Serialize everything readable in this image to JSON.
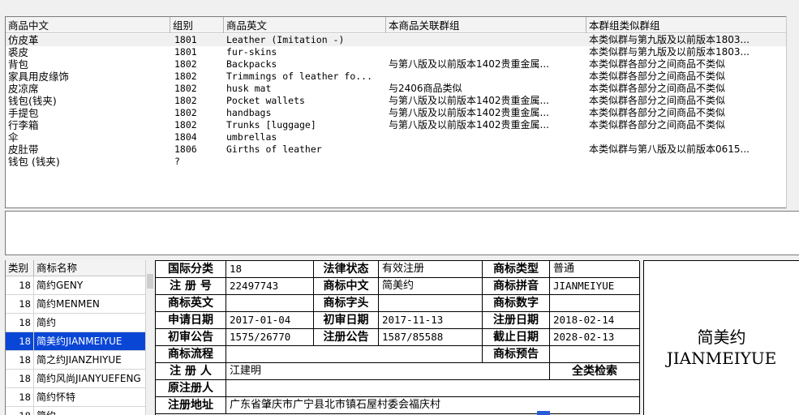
{
  "top_table": {
    "headers": [
      "商品中文",
      "组别",
      "商品英文",
      "本商品关联群组",
      "本群组类似群组"
    ],
    "rows": [
      [
        "仿皮革",
        "1801",
        "Leather (Imitation -)",
        "",
        "本类似群与第九版及以前版本1803..."
      ],
      [
        "裘皮",
        "1801",
        "fur-skins",
        "",
        "本类似群与第九版及以前版本1803..."
      ],
      [
        "背包",
        "1802",
        "Backpacks",
        "与第八版及以前版本1402贵重金属...",
        "本类似群各部分之间商品不类似"
      ],
      [
        "家具用皮缘饰",
        "1802",
        "Trimmings of leather fo...",
        "",
        "本类似群各部分之间商品不类似"
      ],
      [
        "皮凉席",
        "1802",
        "husk mat",
        "与2406商品类似",
        "本类似群各部分之间商品不类似"
      ],
      [
        "钱包(钱夹)",
        "1802",
        "Pocket wallets",
        "与第八版及以前版本1402贵重金属...",
        "本类似群各部分之间商品不类似"
      ],
      [
        "手提包",
        "1802",
        "handbags",
        "与第八版及以前版本1402贵重金属...",
        "本类似群各部分之间商品不类似"
      ],
      [
        "行李箱",
        "1802",
        "Trunks [luggage]",
        "与第八版及以前版本1402贵重金属...",
        "本类似群各部分之间商品不类似"
      ],
      [
        "伞",
        "1804",
        "umbrellas",
        "",
        ""
      ],
      [
        "皮肚带",
        "1806",
        "Girths of leather",
        "",
        "本类似群与第八版及以前版本0615..."
      ],
      [
        "钱包 (钱夹)",
        "?",
        "",
        "",
        ""
      ]
    ]
  },
  "list": {
    "headers": [
      "类别",
      "商标名称"
    ],
    "rows": [
      {
        "cls": "18",
        "name": "简约GENY"
      },
      {
        "cls": "18",
        "name": "简约MENMEN"
      },
      {
        "cls": "18",
        "name": "简约"
      },
      {
        "cls": "18",
        "name": "简美约JIANMEIYUE"
      },
      {
        "cls": "18",
        "name": "简之约JIANZHIYUE"
      },
      {
        "cls": "18",
        "name": "简约风尚JIANYUEFENG"
      },
      {
        "cls": "18",
        "name": "简约怀特"
      },
      {
        "cls": "18",
        "name": "简约..."
      }
    ],
    "active_index": 3
  },
  "detail": {
    "intl_class_label": "国际分类",
    "intl_class": "18",
    "legal_status_label": "法律状态",
    "legal_status": "有效注册",
    "tm_type_label": "商标类型",
    "tm_type": "普通",
    "reg_no_label": "注 册 号",
    "reg_no": "22497743",
    "tm_cn_label": "商标中文",
    "tm_cn": "简美约",
    "tm_pinyin_label": "商标拼音",
    "tm_pinyin": "JIANMEIYUE",
    "tm_en_label": "商标英文",
    "tm_en": "",
    "tm_head_label": "商标字头",
    "tm_head": "",
    "tm_digit_label": "商标数字",
    "tm_digit": "",
    "apply_date_label": "申请日期",
    "apply_date": "2017-01-04",
    "prelim_date_label": "初审日期",
    "prelim_date": "2017-11-13",
    "reg_date_label": "注册日期",
    "reg_date": "2018-02-14",
    "prelim_notice_label": "初审公告",
    "prelim_notice": "1575/26770",
    "reg_notice_label": "注册公告",
    "reg_notice": "1587/85588",
    "expiry_label": "截止日期",
    "expiry": "2028-02-13",
    "flow_label": "商标流程",
    "flow": "",
    "forecast_label": "商标预告",
    "forecast": "",
    "registrant_label": "注 册 人",
    "registrant": "江建明",
    "full_search": "全类检索",
    "orig_registrant_label": "原注册人",
    "orig_registrant": "",
    "address_label": "注册地址",
    "address": "广东省肇庆市广宁县北市镇石屋村委会福庆村"
  },
  "preview": {
    "cn": "简美约",
    "en": "JIANMEIYUE"
  }
}
